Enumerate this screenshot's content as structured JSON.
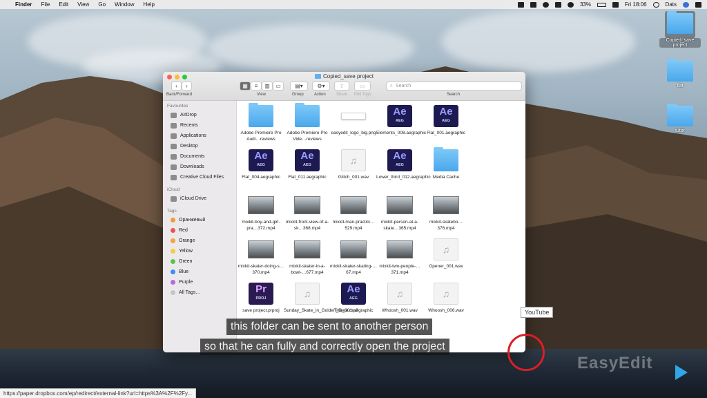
{
  "menubar": {
    "app_name": "Finder",
    "items": [
      "File",
      "Edit",
      "View",
      "Go",
      "Window",
      "Help"
    ],
    "battery": "33%",
    "clock": "Fri 18:06",
    "user": "Dats"
  },
  "desktop_icons": [
    {
      "label": "Copied_save project",
      "selected": true
    },
    {
      "label": "flat",
      "selected": false
    },
    {
      "label": "tutor",
      "selected": false
    }
  ],
  "window": {
    "title": "Copied_save project",
    "toolbar": {
      "back_forward_label": "Back/Forward",
      "view_label": "View",
      "group_label": "Group",
      "action_label": "Action",
      "share_label": "Share",
      "edit_tags_label": "Edit Tags",
      "search_placeholder": "Search",
      "search_label": "Search"
    },
    "sidebar": {
      "favourites_heading": "Favourites",
      "favourites": [
        "AirDrop",
        "Recents",
        "Applications",
        "Desktop",
        "Documents",
        "Downloads",
        "Creative Cloud Files"
      ],
      "icloud_heading": "iCloud",
      "icloud": [
        "iCloud Drive"
      ],
      "tags_heading": "Tags",
      "tags": [
        {
          "label": "Оранжевый",
          "color": "#f29b38"
        },
        {
          "label": "Red",
          "color": "#f0534f"
        },
        {
          "label": "Orange",
          "color": "#f4a23a"
        },
        {
          "label": "Yellow",
          "color": "#f5cd38"
        },
        {
          "label": "Green",
          "color": "#5ac549"
        },
        {
          "label": "Blue",
          "color": "#3c8df5"
        },
        {
          "label": "Purple",
          "color": "#b66ad9"
        },
        {
          "label": "All Tags…",
          "color": "#c5c5c5"
        }
      ]
    },
    "files": [
      {
        "name": "Adobe Premiere Pro Audi…reviews",
        "kind": "folder"
      },
      {
        "name": "Adobe Premiere Pro Vide…reviews",
        "kind": "folder"
      },
      {
        "name": "easyedit_logo_big.png",
        "kind": "png"
      },
      {
        "name": "Elements_008.aegraphic",
        "kind": "ae"
      },
      {
        "name": "Flat_001.aegraphic",
        "kind": "ae"
      },
      {
        "name": "Flat_004.aegraphic",
        "kind": "ae"
      },
      {
        "name": "Flat_011.aegraphic",
        "kind": "ae"
      },
      {
        "name": "Glitch_001.wav",
        "kind": "audio"
      },
      {
        "name": "Lower_third_012.aegraphic",
        "kind": "ae"
      },
      {
        "name": "Media Cache",
        "kind": "folder"
      },
      {
        "name": "mixkit-boy-and-girl-pra…372.mp4",
        "kind": "video"
      },
      {
        "name": "mixkit-front-view-of-a-sk…368.mp4",
        "kind": "video"
      },
      {
        "name": "mixkit-man-practici…529.mp4",
        "kind": "video"
      },
      {
        "name": "mixkit-person-at-a-skate…365.mp4",
        "kind": "video"
      },
      {
        "name": "mixkit-skatebo…376.mp4",
        "kind": "video"
      },
      {
        "name": "mixkit-skater-doing-s…370.mp4",
        "kind": "video"
      },
      {
        "name": "mixkit-skater-in-a-bowl-…677.mp4",
        "kind": "video"
      },
      {
        "name": "mixkit-skater-skating-…67.mp4",
        "kind": "video"
      },
      {
        "name": "mixkit-two-people-…371.mp4",
        "kind": "video"
      },
      {
        "name": "Opener_001.wav",
        "kind": "audio"
      },
      {
        "name": "save project.prproj",
        "kind": "pr"
      },
      {
        "name": "Sunday_Skate_in_Golden_Gate.mp3",
        "kind": "audio"
      },
      {
        "name": "Title_001.aegraphic",
        "kind": "ae"
      },
      {
        "name": "Whoosh_001.wav",
        "kind": "audio"
      },
      {
        "name": "Whoosh_006.wav",
        "kind": "audio"
      }
    ],
    "icon_text": {
      "ae_main": "Ae",
      "ae_sub": "AEG",
      "pr_main": "Pr",
      "pr_sub": "PROJ",
      "audio_glyph": "♫"
    }
  },
  "overlay": {
    "caption_line1": "this folder can be sent to another person",
    "caption_line2": "so that he can fully and correctly open the project",
    "youtube_tooltip": "YouTube",
    "status_url": "https://paper.dropbox.com/ep/redirect/external-link?url=https%3A%2F%2Fy...",
    "watermark": "EasyEdit"
  }
}
